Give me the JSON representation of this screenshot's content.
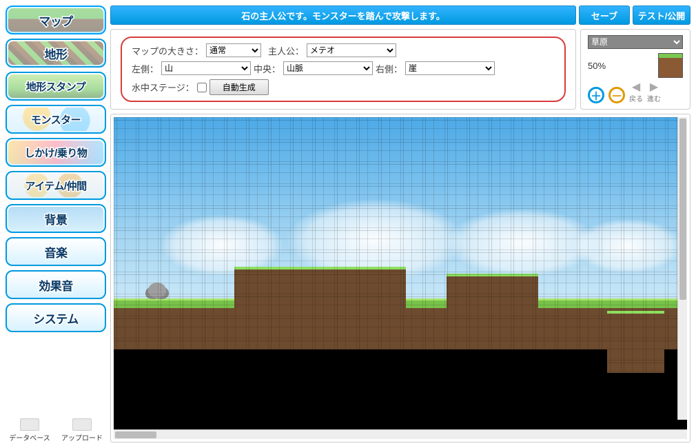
{
  "topbar": {
    "message": "石の主人公です。モンスターを踏んで攻撃します。",
    "save": "セーブ",
    "test_publish": "テスト/公開"
  },
  "sidebar": {
    "items": [
      {
        "id": "map",
        "label": "マップ",
        "thumb": "th-map",
        "active": true
      },
      {
        "id": "terrain",
        "label": "地形",
        "thumb": "th-terrain",
        "active": false
      },
      {
        "id": "stamp",
        "label": "地形スタンプ",
        "thumb": "th-stamp",
        "active": false
      },
      {
        "id": "monster",
        "label": "モンスター",
        "thumb": "th-monster",
        "active": false
      },
      {
        "id": "gimmick",
        "label": "しかけ/乗り物",
        "thumb": "th-gimmick",
        "active": false
      },
      {
        "id": "item",
        "label": "アイテム/仲間",
        "thumb": "th-item",
        "active": false
      },
      {
        "id": "bg",
        "label": "背景",
        "thumb": "th-bg",
        "active": false
      },
      {
        "id": "music",
        "label": "音楽",
        "thumb": "",
        "active": false
      },
      {
        "id": "sfx",
        "label": "効果音",
        "thumb": "",
        "active": false
      },
      {
        "id": "system",
        "label": "システム",
        "thumb": "",
        "active": false
      }
    ],
    "bottom": {
      "database": "データベース",
      "upload": "アップロード"
    }
  },
  "config": {
    "map_size_label": "マップの大きさ：",
    "map_size_value": "通常",
    "hero_label": "主人公：",
    "hero_value": "メテオ",
    "left_label": "左側：",
    "left_value": "山",
    "center_label": "中央：",
    "center_value": "山脈",
    "right_label": "右側：",
    "right_value": "崖",
    "underwater_label": "水中ステージ：",
    "underwater_checked": false,
    "autogen": "自動生成"
  },
  "tools": {
    "tileset_value": "草原",
    "zoom_text": "50%",
    "back": "戻る",
    "forward": "進む"
  },
  "colors": {
    "accent": "#0099e0",
    "highlight_border": "#d93a3a"
  }
}
